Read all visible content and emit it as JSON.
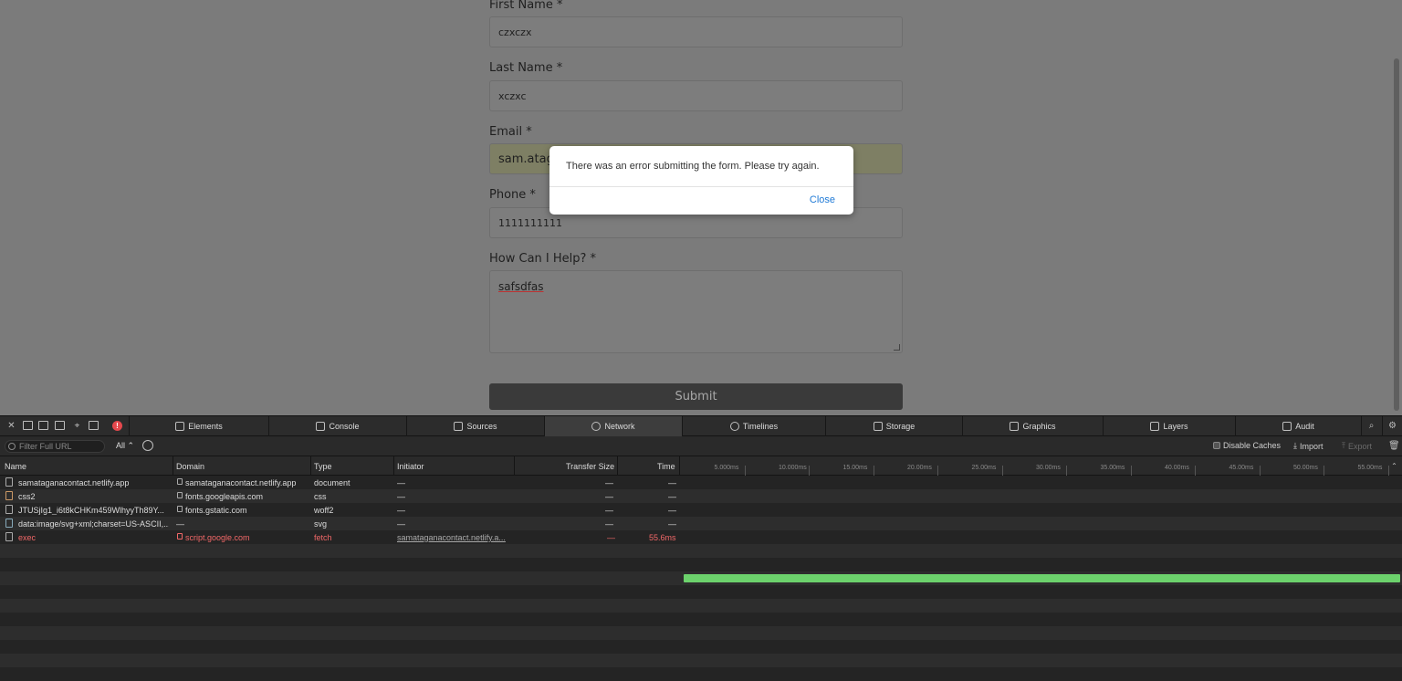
{
  "form": {
    "first_name_label": "First Name *",
    "first_name_value": "czxczx",
    "last_name_label": "Last Name *",
    "last_name_value": "xczxc",
    "email_label": "Email *",
    "email_value": "sam.atag",
    "phone_label": "Phone *",
    "phone_value": "1111111111",
    "help_label": "How Can I Help? *",
    "help_value": "safsdfas",
    "submit_label": "Submit"
  },
  "modal": {
    "message": "There was an error submitting the form. Please try again.",
    "close_label": "Close"
  },
  "devtools": {
    "tabs": [
      "Elements",
      "Console",
      "Sources",
      "Network",
      "Timelines",
      "Storage",
      "Graphics",
      "Layers",
      "Audit"
    ],
    "active_tab": "Network",
    "filter_placeholder": "Filter Full URL",
    "type_filter": "All",
    "disable_caches_label": "Disable Caches",
    "import_label": "Import",
    "export_label": "Export",
    "columns": {
      "name": "Name",
      "domain": "Domain",
      "type": "Type",
      "initiator": "Initiator",
      "transfer_size": "Transfer Size",
      "time": "Time"
    },
    "timeline_ticks": [
      "5.000ms",
      "10.000ms",
      "15.00ms",
      "20.00ms",
      "25.00ms",
      "30.00ms",
      "35.00ms",
      "40.00ms",
      "45.00ms",
      "50.00ms",
      "55.00ms"
    ],
    "requests": [
      {
        "name": "samataganacontact.netlify.app",
        "domain": "samataganacontact.netlify.app",
        "type": "document",
        "initiator": "—",
        "size": "—",
        "time": "—",
        "error": false
      },
      {
        "name": "css2",
        "domain": "fonts.googleapis.com",
        "type": "css",
        "initiator": "—",
        "size": "—",
        "time": "—",
        "error": false
      },
      {
        "name": "JTUSjIg1_i6t8kCHKm459WlhyyTh89Y...",
        "domain": "fonts.gstatic.com",
        "type": "woff2",
        "initiator": "—",
        "size": "—",
        "time": "—",
        "error": false
      },
      {
        "name": "data:image/svg+xml;charset=US-ASCII,...",
        "domain": "—",
        "type": "svg",
        "initiator": "—",
        "size": "—",
        "time": "—",
        "error": false
      },
      {
        "name": "exec",
        "domain": "script.google.com",
        "type": "fetch",
        "initiator": "samataganacontact.netlify.a...",
        "size": "—",
        "time": "55.6ms",
        "error": true
      }
    ],
    "colors": {
      "error_text": "#f26868",
      "timing_bar": "#6cd26c",
      "error_badge": "#e5484d",
      "link_blue": "#1f7ad6"
    }
  }
}
